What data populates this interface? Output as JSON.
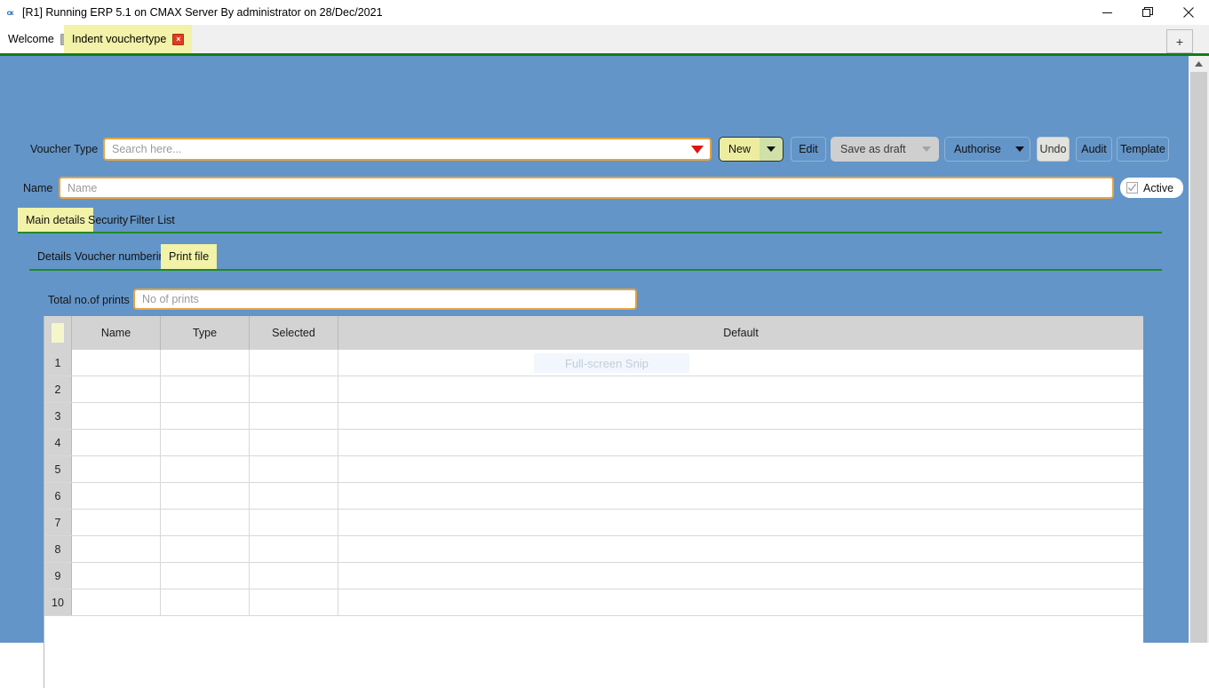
{
  "window": {
    "title": "[R1] Running ERP 5.1 on CMAX Server By administrator on 28/Dec/2021",
    "app_icon": "erp-app-icon",
    "controls": {
      "minimize": "minimize-icon",
      "restore": "restore-icon",
      "close": "close-icon"
    }
  },
  "tabstrip": {
    "tabs": [
      {
        "label": "Welcome",
        "active": false,
        "close": "×"
      },
      {
        "label": "Indent vouchertype",
        "active": true,
        "close": "×"
      }
    ],
    "new_tab_label": "+"
  },
  "form": {
    "voucher_type_label": "Voucher Type",
    "search": {
      "value": "",
      "placeholder": "Search here..."
    },
    "name_label": "Name",
    "name": {
      "value": "",
      "placeholder": "Name"
    },
    "active_label": "Active",
    "active_checked": true
  },
  "toolbar": {
    "buttons": [
      {
        "label": "New",
        "state": "highlight",
        "dropdown": true
      },
      {
        "label": "Edit",
        "state": "normal",
        "dropdown": false
      },
      {
        "label": "Save as draft",
        "state": "disabled",
        "dropdown": true
      },
      {
        "label": "Authorise",
        "state": "normal",
        "dropdown": true
      },
      {
        "label": "Undo",
        "state": "disabled-light",
        "dropdown": false
      },
      {
        "label": "Audit",
        "state": "normal",
        "dropdown": false
      },
      {
        "label": "Template",
        "state": "normal",
        "dropdown": false
      }
    ]
  },
  "tabs_primary": [
    {
      "label": "Main details",
      "active": true
    },
    {
      "label": "Security",
      "active": false
    },
    {
      "label": "Filter List",
      "active": false
    }
  ],
  "tabs_secondary": [
    {
      "label": "Details",
      "active": false
    },
    {
      "label": "Voucher numbering",
      "active": false
    },
    {
      "label": "Print file",
      "active": true
    }
  ],
  "print_file": {
    "total_prints_label": "Total no.of prints",
    "total_prints": {
      "value": "",
      "placeholder": "No of prints"
    }
  },
  "grid": {
    "columns": [
      "",
      "Name",
      "Type",
      "Selected",
      "Default"
    ],
    "rows": [
      {
        "n": "1",
        "name": "",
        "type": "",
        "selected": "",
        "default": ""
      },
      {
        "n": "2",
        "name": "",
        "type": "",
        "selected": "",
        "default": ""
      },
      {
        "n": "3",
        "name": "",
        "type": "",
        "selected": "",
        "default": ""
      },
      {
        "n": "4",
        "name": "",
        "type": "",
        "selected": "",
        "default": ""
      },
      {
        "n": "5",
        "name": "",
        "type": "",
        "selected": "",
        "default": ""
      },
      {
        "n": "6",
        "name": "",
        "type": "",
        "selected": "",
        "default": ""
      },
      {
        "n": "7",
        "name": "",
        "type": "",
        "selected": "",
        "default": ""
      },
      {
        "n": "8",
        "name": "",
        "type": "",
        "selected": "",
        "default": ""
      },
      {
        "n": "9",
        "name": "",
        "type": "",
        "selected": "",
        "default": ""
      },
      {
        "n": "10",
        "name": "",
        "type": "",
        "selected": "",
        "default": ""
      }
    ]
  },
  "overlay": {
    "snip_label": "Full-screen Snip"
  },
  "colors": {
    "panel_blue": "#6395c8",
    "accent_yellow": "#f2f2a8",
    "field_border_orange": "#e8a33d",
    "underline_green": "#1f8a28",
    "header_grey": "#d3d3d3"
  }
}
